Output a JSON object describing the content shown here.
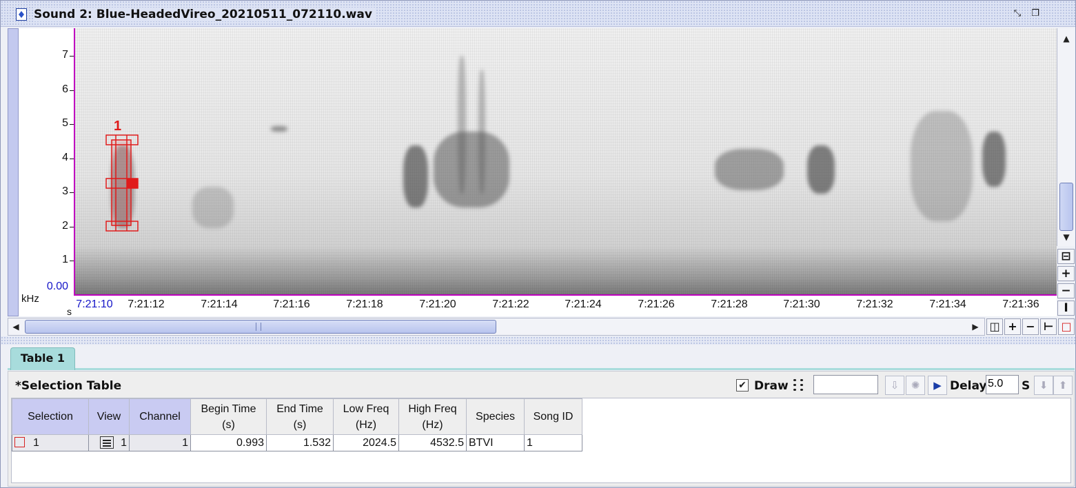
{
  "window": {
    "title": "Sound 2: Blue-HeadedVireo_20210511_072110.wav",
    "icon": "sound-file-icon",
    "controls": [
      "restore-icon",
      "maximize-icon"
    ]
  },
  "spectrogram": {
    "y_axis": {
      "unit": "kHz",
      "ticks": [
        "7",
        "6",
        "5",
        "4",
        "3",
        "2",
        "1",
        "0.00"
      ]
    },
    "x_axis": {
      "unit": "s",
      "ticks": [
        "7:21:10",
        "7:21:12",
        "7:21:14",
        "7:21:16",
        "7:21:18",
        "7:21:20",
        "7:21:22",
        "7:21:24",
        "7:21:26",
        "7:21:28",
        "7:21:30",
        "7:21:32",
        "7:21:34",
        "7:21:36"
      ]
    },
    "selection_label": "1",
    "selection_color": "#e01b1b",
    "axis_color": "#c000c0"
  },
  "view_controls": {
    "vertical_zoom_in": "+",
    "vertical_zoom_out": "−",
    "horizontal_zoom_in": "+",
    "horizontal_zoom_out": "−"
  },
  "tabs": [
    {
      "label": "Table 1"
    }
  ],
  "selection_table": {
    "title": "*Selection Table",
    "draw_label": "Draw",
    "draw_checked": true,
    "draw_value": "",
    "delay_label": "Delay:",
    "delay_value": "5.0",
    "delay_unit": "S",
    "columns": [
      {
        "line1": "Selection",
        "line2": ""
      },
      {
        "line1": "View",
        "line2": ""
      },
      {
        "line1": "Channel",
        "line2": ""
      },
      {
        "line1": "Begin Time",
        "line2": "(s)"
      },
      {
        "line1": "End Time",
        "line2": "(s)"
      },
      {
        "line1": "Low Freq",
        "line2": "(Hz)"
      },
      {
        "line1": "High Freq",
        "line2": "(Hz)"
      },
      {
        "line1": "Species",
        "line2": ""
      },
      {
        "line1": "Song ID",
        "line2": ""
      }
    ],
    "rows": [
      {
        "selection": "1",
        "view": "1",
        "channel": "1",
        "begin_time": "0.993",
        "end_time": "1.532",
        "low_freq": "2024.5",
        "high_freq": "4532.5",
        "species": "BTVI",
        "song_id": "1"
      }
    ]
  }
}
